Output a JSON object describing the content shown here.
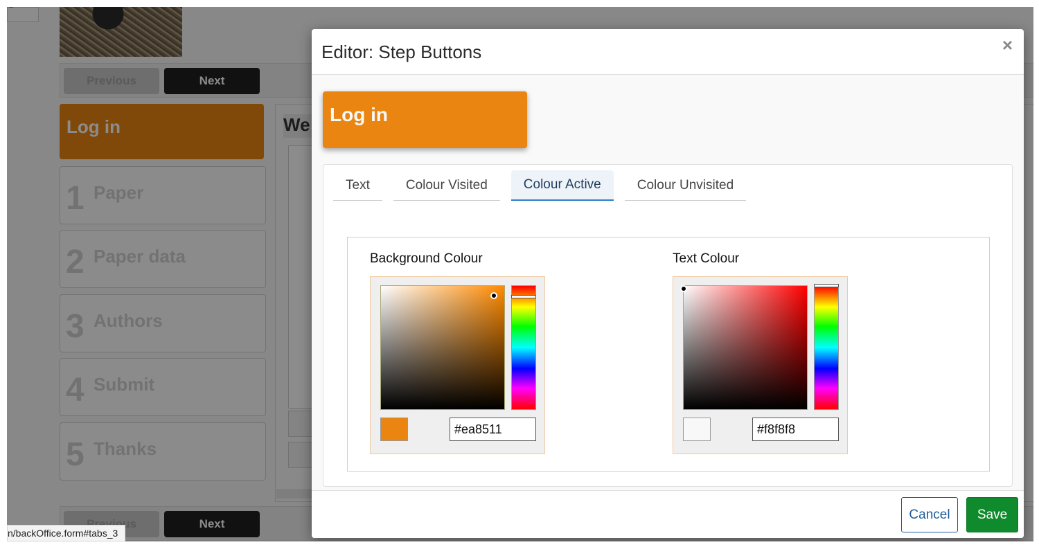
{
  "background": {
    "nav": {
      "previous_label": "Previous",
      "next_label": "Next"
    },
    "steps": [
      {
        "num": "",
        "label": "Log in"
      },
      {
        "num": "1",
        "label": "Paper"
      },
      {
        "num": "2",
        "label": "Paper data"
      },
      {
        "num": "3",
        "label": "Authors"
      },
      {
        "num": "4",
        "label": "Submit"
      },
      {
        "num": "5",
        "label": "Thanks"
      }
    ],
    "content_title": "We",
    "status_url": "n/backOffice.form#tabs_3"
  },
  "modal": {
    "title": "Editor: Step Buttons",
    "close_icon": "close-icon",
    "preview_label": "Log in",
    "tabs": [
      "Text",
      "Colour Visited",
      "Colour Active",
      "Colour Unvisited"
    ],
    "active_tab": "Colour Active",
    "background_colour": {
      "title": "Background Colour",
      "value": "#ea8511",
      "hue": "#ff8a00"
    },
    "text_colour": {
      "title": "Text Colour",
      "value": "#f8f8f8",
      "hue": "#ff0000"
    },
    "cancel_label": "Cancel",
    "save_label": "Save"
  },
  "colors": {
    "accent_orange": "#ea8511",
    "save_green": "#0f8a2c",
    "cancel_blue": "#1f5d9a",
    "active_tab_underline": "#2c7fc7"
  }
}
